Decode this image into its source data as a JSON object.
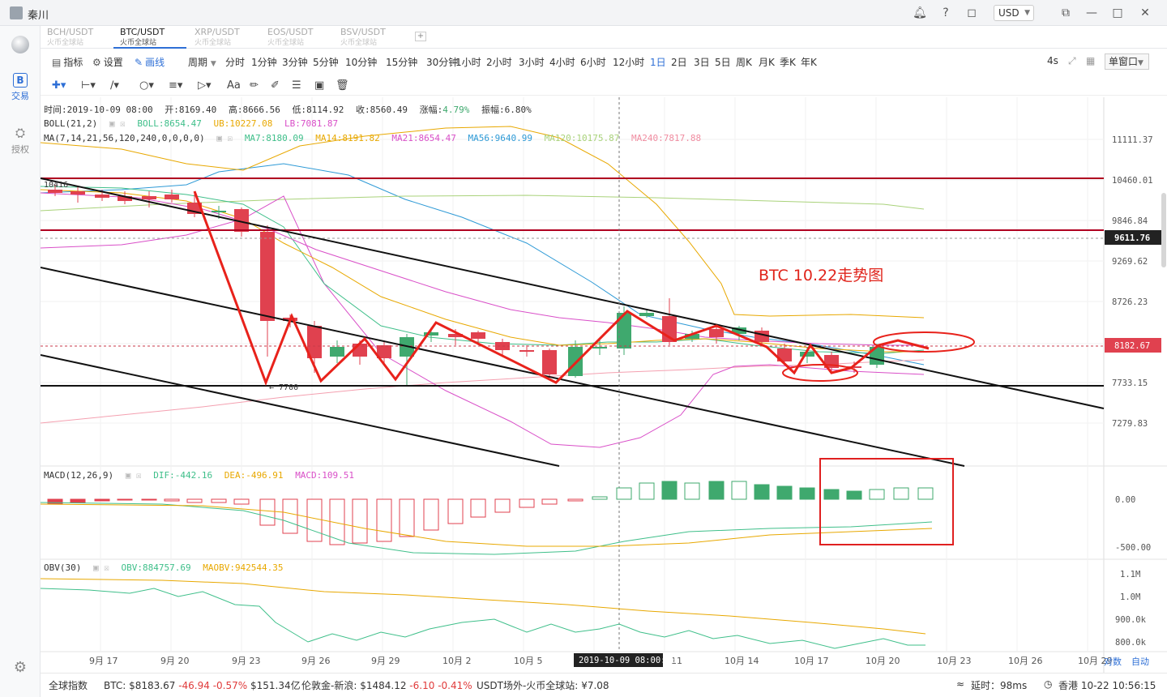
{
  "app": {
    "username": "秦川",
    "currency": "USD"
  },
  "rail": {
    "trade_label": "交易",
    "auth_label": "授权"
  },
  "symbol_tabs": [
    {
      "label": "BCH/USDT",
      "sub": "火币全球站"
    },
    {
      "label": "BTC/USDT",
      "sub": "火币全球站"
    },
    {
      "label": "XRP/USDT",
      "sub": "火币全球站"
    },
    {
      "label": "EOS/USDT",
      "sub": "火币全球站"
    },
    {
      "label": "BSV/USDT",
      "sub": "火币全球站"
    }
  ],
  "toolbar": {
    "indicator_label": "指标",
    "settings_label": "设置",
    "draw_label": "画线",
    "period_label": "周期",
    "periods": [
      "分时",
      "1分钟",
      "3分钟",
      "5分钟",
      "10分钟",
      "15分钟",
      "30分钟",
      "1小时",
      "2小时",
      "3小时",
      "4小时",
      "6小时",
      "12小时",
      "1日",
      "2日",
      "3日",
      "5日",
      "周K",
      "月K",
      "季K",
      "年K"
    ],
    "active_period": "1日",
    "refresh": "4s",
    "window_mode": "单窗口"
  },
  "info": {
    "time_label": "时间:",
    "time": "2019-10-09 08:00",
    "open_label": "开:",
    "open": "8169.40",
    "high_label": "高:",
    "high": "8666.56",
    "low_label": "低:",
    "low": "8114.92",
    "close_label": "收:",
    "close": "8560.49",
    "chg_label": "涨幅:",
    "chg": "4.79%",
    "amp_label": "振幅:",
    "amp": "6.80%"
  },
  "boll": {
    "name": "BOLL(21,2)",
    "boll": "BOLL:8654.47",
    "ub": "UB:10227.08",
    "lb": "LB:7081.87"
  },
  "ma": {
    "name": "MA(7,14,21,56,120,240,0,0,0,0)",
    "ma7": "MA7:8180.09",
    "ma14": "MA14:8191.82",
    "ma21": "MA21:8654.47",
    "ma56": "MA56:9640.99",
    "ma120": "MA120:10175.87",
    "ma240": "MA240:7817.88"
  },
  "macd": {
    "name": "MACD(12,26,9)",
    "dif": "DIF:-442.16",
    "dea": "DEA:-496.91",
    "macd": "MACD:109.51"
  },
  "obv": {
    "name": "OBV(30)",
    "obv": "OBV:884757.69",
    "maobv": "MAOBV:942544.35"
  },
  "annotation": "BTC 10.22走势图",
  "labels": {
    "high_mark": "10416",
    "low_mark": "7700"
  },
  "price_axis": [
    "11111.37",
    "10460.01",
    "9846.84",
    "9269.62",
    "8726.23",
    "7733.15",
    "7279.83"
  ],
  "price_tags": {
    "resistance": "9611.76",
    "current": "8182.67"
  },
  "macd_axis": [
    "0.00",
    "-500.00"
  ],
  "obv_axis": [
    "1.1M",
    "1.0M",
    "900.0k",
    "800.0k"
  ],
  "date_axis": [
    "9月 17",
    "9月 20",
    "9月 23",
    "9月 26",
    "9月 29",
    "10月 2",
    "10月 5",
    "11",
    "10月 14",
    "10月 17",
    "10月 20",
    "10月 23",
    "10月 26",
    "10月 29"
  ],
  "crosshair_date": "2019-10-09 08:00:00",
  "axis_modes": {
    "log": "对数",
    "auto": "自动"
  },
  "status": {
    "index_label": "全球指数",
    "btc_label": "BTC:",
    "btc_price": "$8183.67",
    "btc_chg": "-46.94",
    "btc_pct": "-0.57%",
    "btc_vol": "$151.34亿",
    "gold_label": "伦敦金-新浪:",
    "gold_price": "$1484.12",
    "gold_chg": "-6.10",
    "gold_pct": "-0.41%",
    "usdt_label": "USDT场外-火币全球站:",
    "usdt_price": "¥7.08",
    "latency": "延时：98ms",
    "clock": "香港 10-22 10:56:15"
  },
  "colors": {
    "up": "#3fa96e",
    "down": "#e0414f",
    "accent": "#2e6fd6",
    "annotation": "#e0241b"
  }
}
